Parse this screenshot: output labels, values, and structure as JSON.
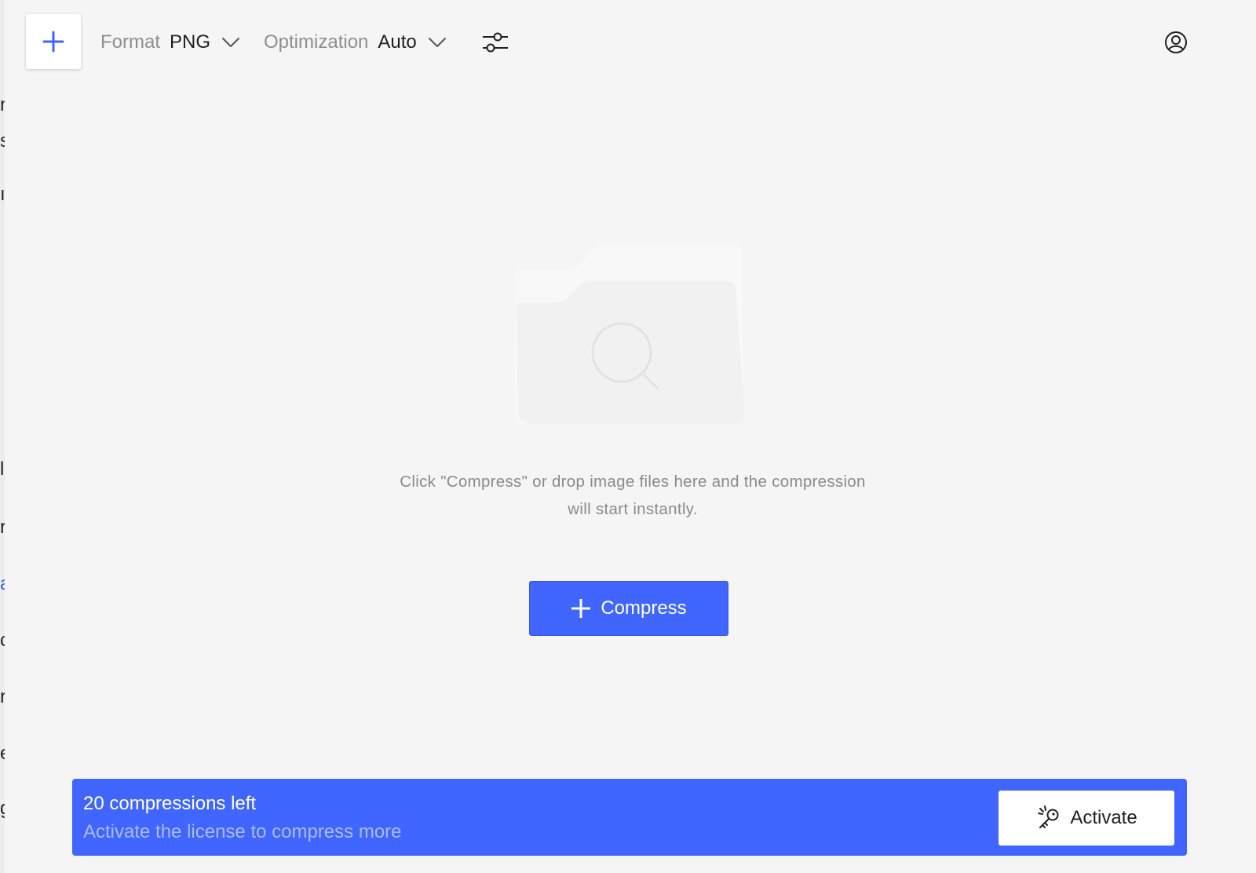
{
  "toolbar": {
    "format_label": "Format",
    "format_value": "PNG",
    "optimization_label": "Optimization",
    "optimization_value": "Auto"
  },
  "icons": {
    "add": "plus-icon",
    "dropdown": "chevron-down-icon",
    "settings": "sliders-icon",
    "account": "user-circle-icon",
    "empty": "folder-search-icon",
    "activate": "key-icon"
  },
  "empty_state": {
    "message": "Click \"Compress\" or drop image files here and the compression will start instantly.",
    "button_label": "Compress"
  },
  "banner": {
    "title": "20 compressions left",
    "subtitle": "Activate the license to compress more",
    "button_label": "Activate"
  },
  "colors": {
    "accent": "#4066ff",
    "background": "#f5f5f5"
  }
}
